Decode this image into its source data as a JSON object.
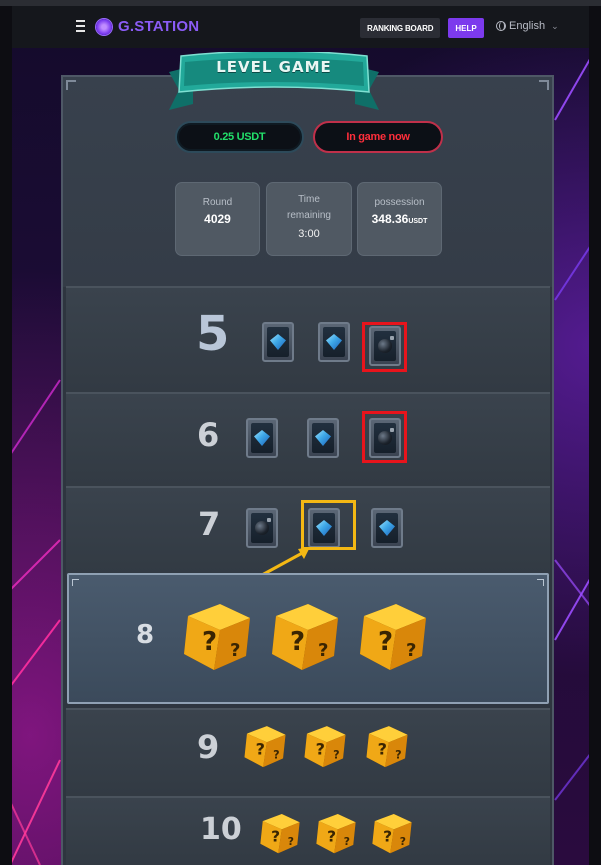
{
  "header": {
    "logo_text": "G.STATION",
    "ranking_label": "RANKING BOARD",
    "help_label": "HELP",
    "language": "English"
  },
  "game": {
    "banner_title": "LEVEL GAME",
    "price": "0.25 USDT",
    "status": "In game now",
    "round_label": "Round",
    "round_value": "4029",
    "time_label": "Time remaining",
    "time_value": "3:00",
    "possession_label": "possession",
    "possession_value": "348.36",
    "possession_unit": "USDT"
  },
  "levels": [
    {
      "level": "5",
      "tiles": [
        "gem",
        "gem",
        "bomb"
      ],
      "highlight": "bomb-red"
    },
    {
      "level": "6",
      "tiles": [
        "gem",
        "gem",
        "bomb"
      ],
      "highlight": "bomb-red"
    },
    {
      "level": "7",
      "tiles": [
        "bomb",
        "gem",
        "gem"
      ],
      "highlight": "gem-yellow"
    },
    {
      "level": "8",
      "tiles": [
        "mystery",
        "mystery",
        "mystery"
      ],
      "active": true
    },
    {
      "level": "9",
      "tiles": [
        "mystery",
        "mystery",
        "mystery"
      ]
    },
    {
      "level": "10",
      "tiles": [
        "mystery",
        "mystery",
        "mystery"
      ]
    }
  ],
  "colors": {
    "accent": "#7c3aed",
    "price_text": "#22e06a",
    "status_text": "#ff2e3b",
    "bomb_highlight": "#e8141c",
    "pick_highlight": "#f4b814"
  }
}
